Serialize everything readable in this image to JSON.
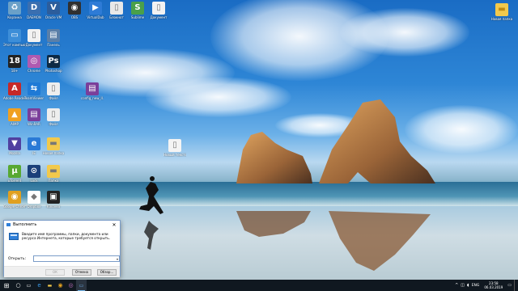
{
  "desktop": {
    "icons_left": [
      {
        "label": "Корзина",
        "icon": "recycle-bin-icon",
        "color": "#6aa0c8",
        "g": "♻"
      },
      {
        "label": "DAEMON",
        "icon": "daemon-tools-icon",
        "color": "#3a6fb0",
        "g": "D"
      },
      {
        "label": "Oracle VM",
        "icon": "virtualbox-icon",
        "color": "#2c5d9c",
        "g": "V"
      },
      {
        "label": "OBS",
        "icon": "obs-icon",
        "color": "#303030",
        "g": "◉"
      },
      {
        "label": "VirtualDub",
        "icon": "vdub-icon",
        "color": "#2e7bd6",
        "g": "▶"
      },
      {
        "label": "Блокнот",
        "icon": "notepad-icon",
        "color": "#e8e8e8",
        "g": "▯"
      },
      {
        "label": "Sublime",
        "icon": "file-icon",
        "color": "#4aa04a",
        "g": "S"
      },
      {
        "label": "Документ",
        "icon": "doc-icon",
        "color": "#f2f2f2",
        "g": "▯"
      },
      {
        "label": "Этот компьютер",
        "icon": "this-pc-icon",
        "color": "#3d8ed8",
        "g": "▭"
      },
      {
        "label": "Документ",
        "icon": "doc-icon",
        "color": "#f2f2f2",
        "g": "▯"
      },
      {
        "label": "Панель",
        "icon": "control-panel-icon",
        "color": "#5a7fa8",
        "g": "▤"
      },
      {
        "label": "18+",
        "icon": "age-icon",
        "color": "#222",
        "g": "18"
      },
      {
        "label": "Chrome",
        "icon": "chrome-alt-icon",
        "color": "#b05ab0",
        "g": "◎"
      },
      {
        "label": "Photoshop",
        "icon": "photoshop-icon",
        "color": "#0d2a45",
        "g": "Ps"
      },
      {
        "label": "Adobe Reader",
        "icon": "acrobat-icon",
        "color": "#c62828",
        "g": "A"
      },
      {
        "label": "TeamViewer",
        "icon": "teamviewer-icon",
        "color": "#1f7ad6",
        "g": "⇆"
      },
      {
        "label": "Файл",
        "icon": "file-icon",
        "color": "#eeeeee",
        "g": "▯"
      },
      {
        "label": "AIMP",
        "icon": "aimp-icon",
        "color": "#f0a020",
        "g": "▲"
      },
      {
        "label": "WinRAR",
        "icon": "winrar-icon",
        "color": "#7a3f9a",
        "g": "▤"
      },
      {
        "label": "Файл",
        "icon": "file-icon",
        "color": "#eeeeee",
        "g": "▯"
      },
      {
        "label": "Mozilla",
        "icon": "app-icon",
        "color": "#5040a0",
        "g": "▼"
      },
      {
        "label": "IE",
        "icon": "ie-icon",
        "color": "#2a7ad6",
        "g": "e"
      },
      {
        "label": "Новая папка",
        "icon": "folder-icon",
        "color": "#f2c94c",
        "g": "▬"
      },
      {
        "label": "uTorrent",
        "icon": "utorrent-icon",
        "color": "#58a832",
        "g": "µ"
      },
      {
        "label": "Lock",
        "icon": "lock-icon",
        "color": "#1a3f7a",
        "g": "⊙"
      },
      {
        "label": "Папка",
        "icon": "folder-icon",
        "color": "#f2c94c",
        "g": "▬"
      },
      {
        "label": "Google Chrome",
        "icon": "chrome-icon",
        "color": "#e0a020",
        "g": "◉"
      },
      {
        "label": "Dropbox",
        "icon": "dropbox-icon",
        "color": "#ffffff",
        "g": "◆"
      },
      {
        "label": "Kinovea",
        "icon": "video-icon",
        "color": "#222",
        "g": "▣"
      }
    ],
    "icon_middle": {
      "label": "Новый текстовый...",
      "icon": "text-file-icon"
    },
    "icon_winrar": {
      "label": "config_new_ll...",
      "icon": "winrar-archive-icon"
    },
    "icon_right": {
      "label": "Новая папка",
      "icon": "folder-icon"
    }
  },
  "run_dialog": {
    "title": "Выполнить",
    "close": "✕",
    "description": "Введите имя программы, папки, документа или ресурса Интернета, которые требуется открыть.",
    "open_label": "Открыть:",
    "input_value": "",
    "dropdown": "▾",
    "ok": "ОК",
    "cancel": "Отмена",
    "browse": "Обзор..."
  },
  "taskbar": {
    "start": "⊞",
    "search": "○",
    "task_view": "▭",
    "apps": [
      "e",
      "▬",
      "◉",
      "◎",
      "▭"
    ],
    "tray": {
      "chevron": "^",
      "network": "◫",
      "volume": "◖",
      "lang": "ENG",
      "time": "23:58",
      "date": "06.03.2019",
      "notify": "▭"
    }
  }
}
